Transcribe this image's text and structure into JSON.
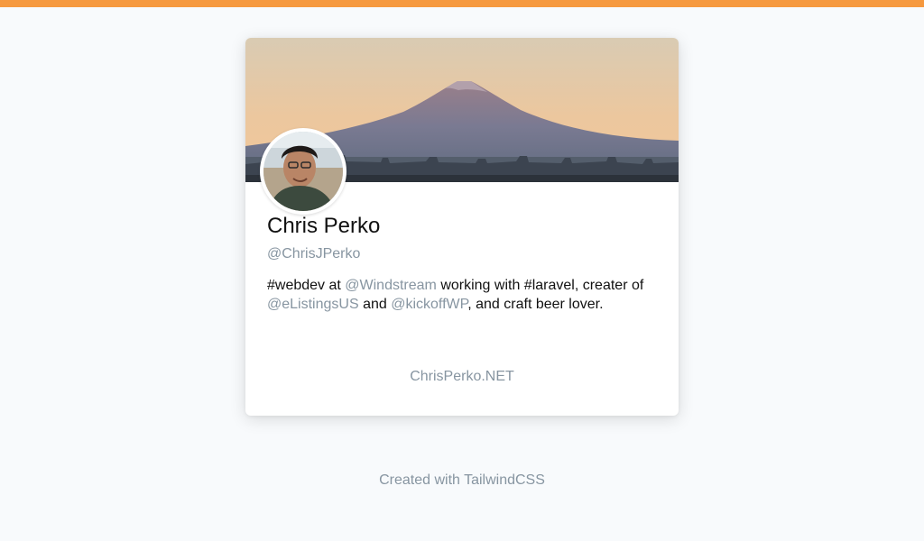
{
  "profile": {
    "name": "Chris Perko",
    "handle": "@ChrisJPerko",
    "website": "ChrisPerko.NET"
  },
  "bio": {
    "t1": "#webdev at ",
    "m1": "@Windstream",
    "t2": " working with #laravel, creater of ",
    "m2": "@eListingsUS",
    "t3": " and ",
    "m3": "@kickoffWP",
    "t4": ", and craft beer lover."
  },
  "footer": {
    "text": "Created with TailwindCSS"
  },
  "colors": {
    "top_bar": "#f6993f",
    "muted_text": "#8795a1",
    "page_bg": "#f8fafc"
  }
}
